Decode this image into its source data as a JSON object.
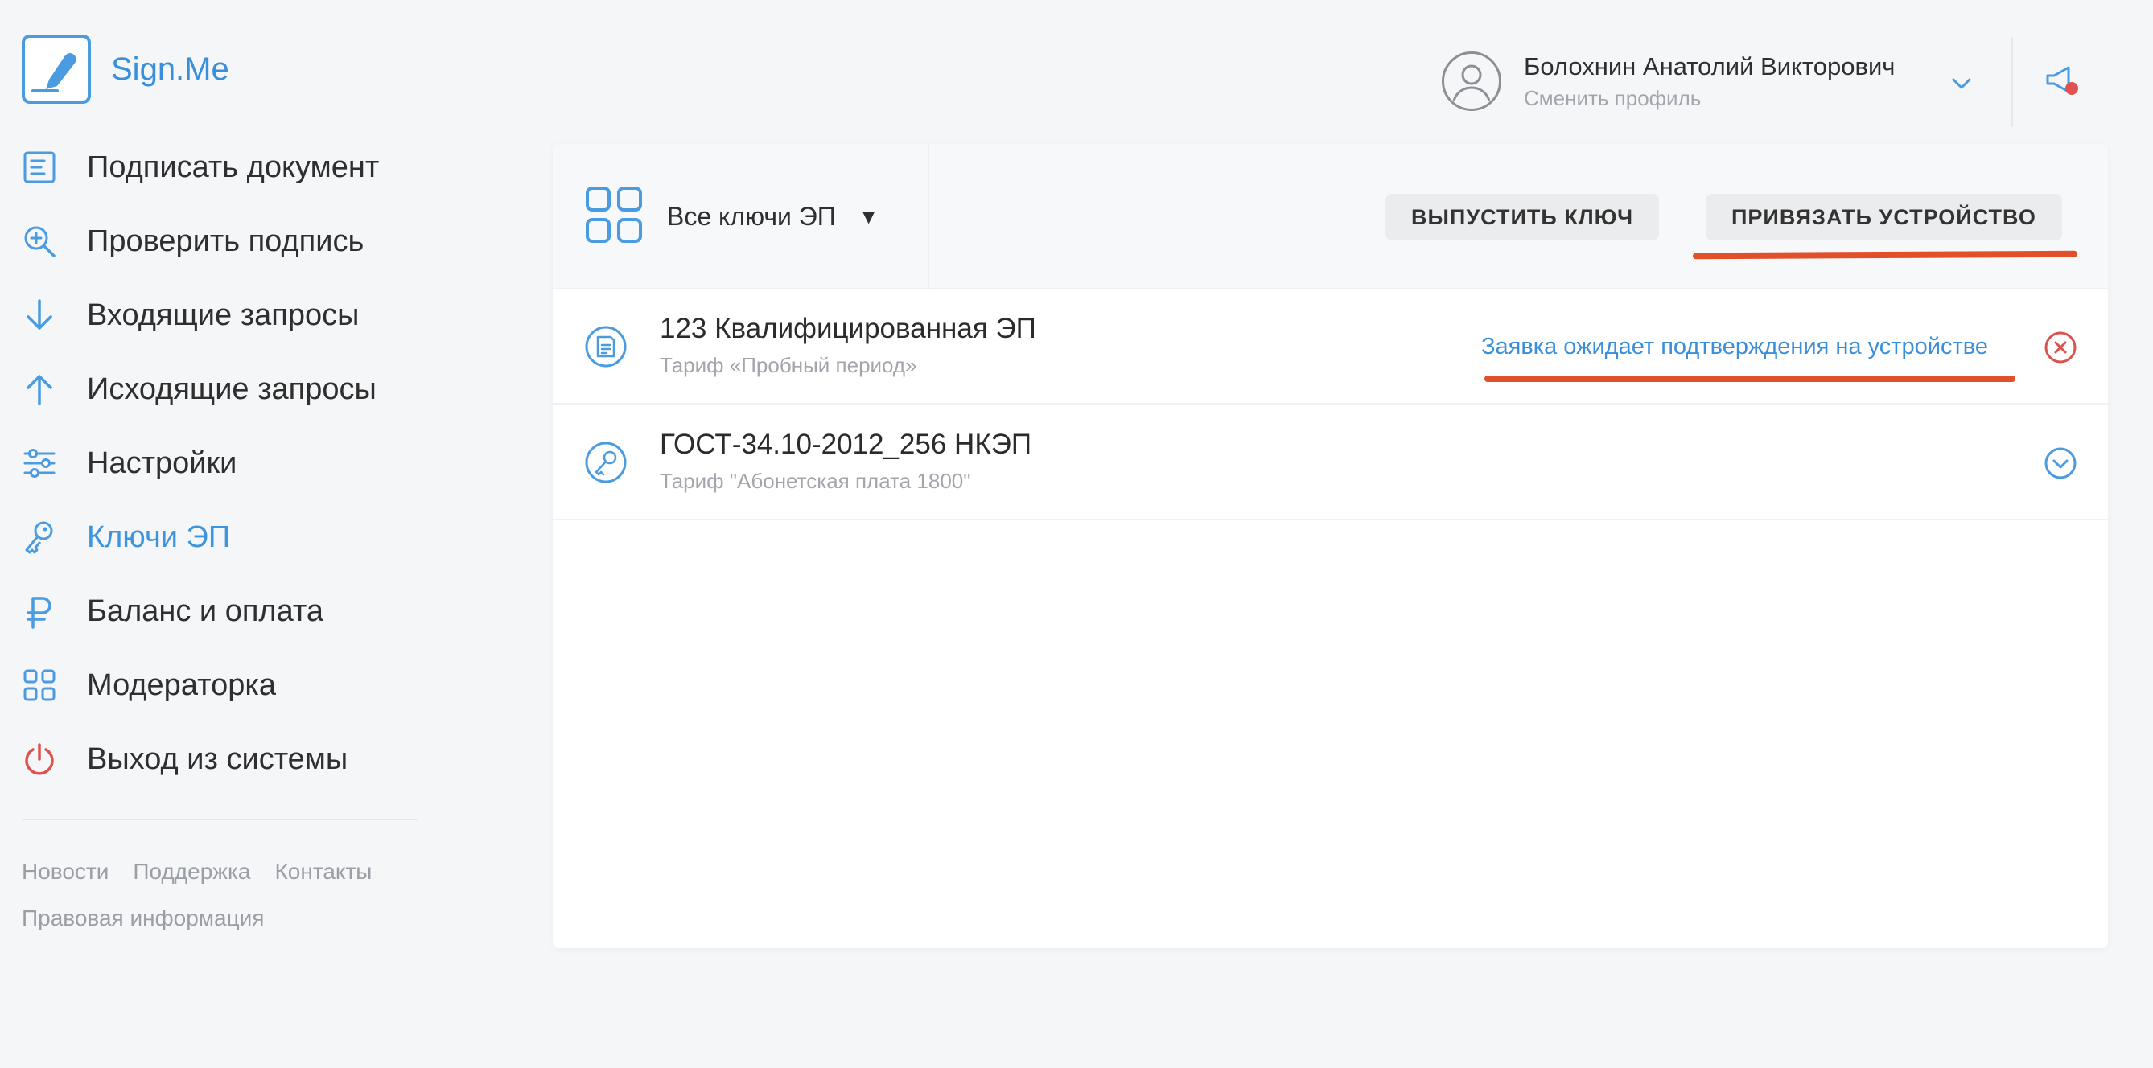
{
  "app": {
    "name": "Sign.Me"
  },
  "colors": {
    "accent": "#3d95dd",
    "highlight": "#e2502b",
    "danger": "#d9534f"
  },
  "sidebar": {
    "items": [
      {
        "label": "Подписать документ",
        "icon": "document-icon"
      },
      {
        "label": "Проверить подпись",
        "icon": "search-check-icon"
      },
      {
        "label": "Входящие запросы",
        "icon": "arrow-down-icon"
      },
      {
        "label": "Исходящие запросы",
        "icon": "arrow-up-icon"
      },
      {
        "label": "Настройки",
        "icon": "sliders-icon"
      },
      {
        "label": "Ключи ЭП",
        "icon": "key-icon",
        "active": true
      },
      {
        "label": "Баланс и оплата",
        "icon": "ruble-icon"
      },
      {
        "label": "Модераторка",
        "icon": "grid-icon"
      },
      {
        "label": "Выход из системы",
        "icon": "power-icon"
      }
    ],
    "footer": {
      "news": "Новости",
      "support": "Поддержка",
      "contacts": "Контакты",
      "legal": "Правовая информация"
    }
  },
  "header": {
    "user_name": "Болохнин Анатолий Викторович",
    "switch_profile": "Сменить профиль"
  },
  "toolbar": {
    "filter_label": "Все ключи ЭП",
    "issue_key": "ВЫПУСТИТЬ КЛЮЧ",
    "bind_device": "ПРИВЯЗАТЬ УСТРОЙСТВО"
  },
  "keys": [
    {
      "title": "123 Квалифицированная ЭП",
      "tariff": "Тариф «Пробный период»",
      "status": "Заявка ожидает подтверждения на устройстве",
      "action_icon": "close-circle-icon"
    },
    {
      "title": "ГОСТ-34.10-2012_256 НКЭП",
      "tariff": "Тариф \"Абонетская плата 1800\"",
      "status": "",
      "action_icon": "chevron-down-circle-icon"
    }
  ]
}
